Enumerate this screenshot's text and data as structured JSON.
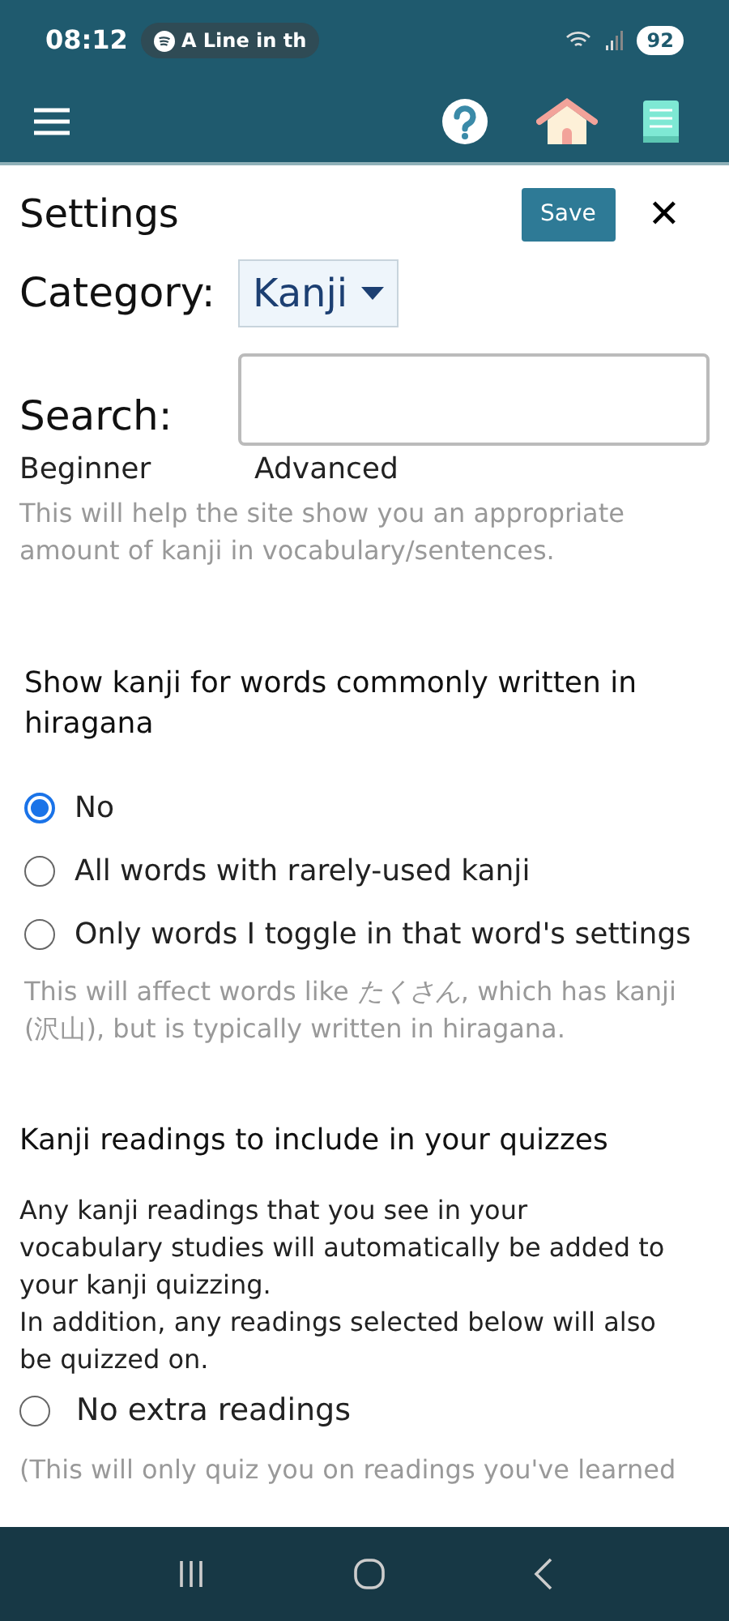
{
  "status_bar": {
    "time": "08:12",
    "media": "A Line in th",
    "battery": "92"
  },
  "settings": {
    "title": "Settings",
    "save": "Save",
    "close": "✕",
    "category_label": "Category:",
    "category_value": "Kanji",
    "search_label": "Search:",
    "level_labels": [
      "Beginner",
      "Advanced"
    ],
    "level_note": "This will help the site show you an appropriate amount of kanji in vocabulary/sentences.",
    "hiragana": {
      "heading": "Show kanji for words commonly written in hiragana",
      "options": [
        {
          "label": "No",
          "selected": true
        },
        {
          "label": "All words with rarely-used kanji",
          "selected": false
        },
        {
          "label": "Only words I toggle in that word's settings",
          "selected": false
        }
      ],
      "note": "This will affect words like *たくさん*, which has kanji (沢山), but is typically written in hiragana."
    },
    "readings": {
      "heading": "Kanji readings to include in your quizzes",
      "intro": [
        "Any kanji readings that you see in your vocabulary studies will automatically be added to your kanji quizzing.",
        "In addition, any readings selected below will also be quizzed on."
      ],
      "options": [
        {
          "label": "No extra readings",
          "selected": false
        }
      ],
      "note": "(This will only quiz you on readings you've learned"
    }
  }
}
